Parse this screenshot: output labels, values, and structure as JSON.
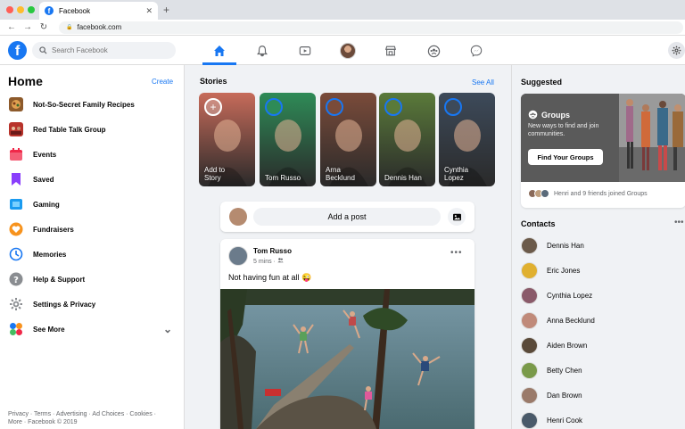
{
  "browser": {
    "tab_title": "Facebook",
    "tab_favicon": "f",
    "close_glyph": "✕",
    "newtab_glyph": "+",
    "url": "facebook.com",
    "back_glyph": "←",
    "forward_glyph": "→",
    "reload_glyph": "↻",
    "lock_glyph": "🔒"
  },
  "header": {
    "logo_letter": "f",
    "search_placeholder": "Search Facebook",
    "nav": [
      {
        "name": "home",
        "icon": "home-icon"
      },
      {
        "name": "notifications",
        "icon": "bell-icon"
      },
      {
        "name": "watch",
        "icon": "video-icon"
      },
      {
        "name": "profile",
        "icon": "avatar"
      },
      {
        "name": "marketplace",
        "icon": "shop-icon"
      },
      {
        "name": "groups",
        "icon": "groups-icon"
      },
      {
        "name": "messenger",
        "icon": "messenger-icon"
      }
    ],
    "settings_icon": "gear-icon"
  },
  "left": {
    "title": "Home",
    "create_label": "Create",
    "menu": [
      {
        "label": "Not-So-Secret Family Recipes",
        "icon": "recipe-thumb",
        "color": "#8d5a2b"
      },
      {
        "label": "Red Table Talk Group",
        "icon": "group-thumb",
        "color": "#b8332b"
      },
      {
        "label": "Events",
        "icon": "calendar-icon",
        "color": "#f02849"
      },
      {
        "label": "Saved",
        "icon": "bookmark-icon",
        "color": "#8a3ffc"
      },
      {
        "label": "Gaming",
        "icon": "gaming-icon",
        "color": "#1a9bf0"
      },
      {
        "label": "Fundraisers",
        "icon": "heart-icon",
        "color": "#f7931e"
      },
      {
        "label": "Memories",
        "icon": "clock-icon",
        "color": "#1877f2"
      },
      {
        "label": "Help & Support",
        "icon": "help-icon",
        "color": "#8a8d91"
      },
      {
        "label": "Settings & Privacy",
        "icon": "gear-icon",
        "color": "#8a8d91"
      },
      {
        "label": "See More",
        "icon": "see-more-icon",
        "color": "#45bd62"
      }
    ],
    "see_more_chevron": "⌄",
    "footer_line1": "Privacy · Terms · Advertising · Ad Choices · Cookies ·",
    "footer_line2": "More · Facebook © 2019"
  },
  "stories": {
    "title": "Stories",
    "see_all": "See All",
    "items": [
      {
        "name": "Add to Story",
        "line1": "Add to",
        "line2": "Story",
        "color": "#c76b5a"
      },
      {
        "name": "Tom Russo",
        "line1": "Tom Russo",
        "line2": "",
        "color": "#2e8b57"
      },
      {
        "name": "Arna Becklund",
        "line1": "Arna",
        "line2": "Becklund",
        "color": "#7a4b3a"
      },
      {
        "name": "Dennis Han",
        "line1": "Dennis Han",
        "line2": "",
        "color": "#5a7a3a"
      },
      {
        "name": "Cynthia Lopez",
        "line1": "Cynthia",
        "line2": "Lopez",
        "color": "#3d4a5a"
      }
    ],
    "add_glyph": "+"
  },
  "composer": {
    "button_label": "Add a post",
    "photo_icon": "photo-icon"
  },
  "post": {
    "author": "Tom Russo",
    "time": "5 mins ·",
    "audience_icon": "friends-icon",
    "menu": "•••",
    "text": "Not having fun at all",
    "emoji": "😜"
  },
  "suggested": {
    "title": "Suggested",
    "card_title": "Groups",
    "card_desc": "New ways to find and join communities.",
    "button": "Find Your Groups",
    "footer": "Henri and 9 friends joined Groups"
  },
  "contacts": {
    "title": "Contacts",
    "menu": "•••",
    "items": [
      {
        "name": "Dennis Han",
        "color": "#6b5a4a"
      },
      {
        "name": "Eric Jones",
        "color": "#e0b030"
      },
      {
        "name": "Cynthia Lopez",
        "color": "#8a5a6a"
      },
      {
        "name": "Anna Becklund",
        "color": "#c08a7a"
      },
      {
        "name": "Aiden Brown",
        "color": "#5a4a3a"
      },
      {
        "name": "Betty Chen",
        "color": "#7a9a4a"
      },
      {
        "name": "Dan Brown",
        "color": "#9a7a6a"
      },
      {
        "name": "Henri Cook",
        "color": "#4a5a6a"
      }
    ]
  },
  "colors": {
    "accent": "#1877f2",
    "bg": "#f0f2f5"
  }
}
